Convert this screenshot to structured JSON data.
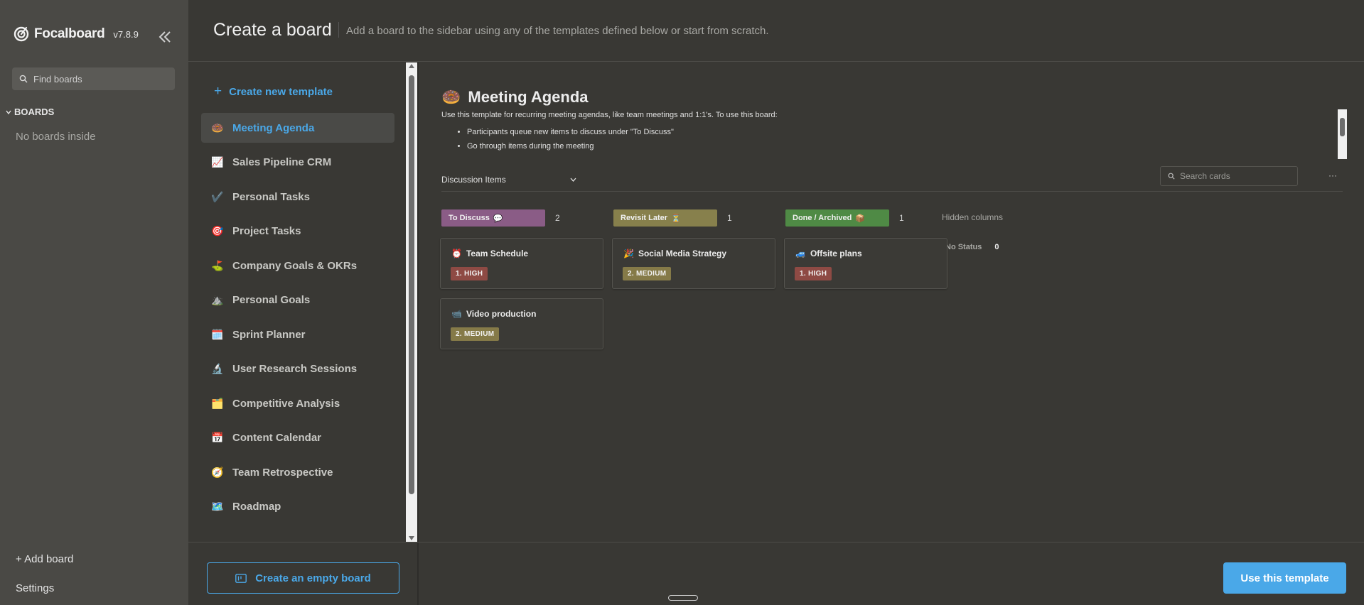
{
  "sidebar": {
    "brand": "Focalboard",
    "version": "v7.8.9",
    "search_placeholder": "Find boards",
    "boards_header": "BOARDS",
    "empty_text": "No boards inside",
    "add_board": "+ Add board",
    "settings": "Settings"
  },
  "header": {
    "title": "Create a board",
    "subtitle": "Add a board to the sidebar using any of the templates defined below or start from scratch."
  },
  "templates": {
    "create_new": "Create new template",
    "items": [
      {
        "label": "Meeting Agenda",
        "icon": "🍩",
        "active": true
      },
      {
        "label": "Sales Pipeline CRM",
        "icon": "📈",
        "active": false
      },
      {
        "label": "Personal Tasks",
        "icon": "✔️",
        "active": false
      },
      {
        "label": "Project Tasks",
        "icon": "🎯",
        "active": false
      },
      {
        "label": "Company Goals & OKRs",
        "icon": "⛳",
        "active": false
      },
      {
        "label": "Personal Goals",
        "icon": "⛰️",
        "active": false
      },
      {
        "label": "Sprint Planner",
        "icon": "🗓️",
        "active": false
      },
      {
        "label": "User Research Sessions",
        "icon": "🔬",
        "active": false
      },
      {
        "label": "Competitive Analysis",
        "icon": "🗂️",
        "active": false
      },
      {
        "label": "Content Calendar",
        "icon": "📅",
        "active": false
      },
      {
        "label": "Team Retrospective",
        "icon": "🧭",
        "active": false
      },
      {
        "label": "Roadmap",
        "icon": "🗺️",
        "active": false
      }
    ]
  },
  "preview": {
    "title": "Meeting Agenda",
    "icon": "🍩",
    "description": "Use this template for recurring meeting agendas, like team meetings and 1:1's. To use this board:",
    "bullets": [
      "Participants queue new items to discuss under \"To Discuss\"",
      "Go through items during the meeting"
    ],
    "view_name": "Discussion Items",
    "search_placeholder": "Search cards",
    "more": "···",
    "columns": [
      {
        "label": "To Discuss",
        "icon": "💬",
        "count": "2",
        "color": "#8a5c86"
      },
      {
        "label": "Revisit Later",
        "icon": "⏳",
        "count": "1",
        "color": "#87804c"
      },
      {
        "label": "Done / Archived",
        "icon": "📦",
        "count": "1",
        "color": "#4f8a45"
      }
    ],
    "hidden_columns": "Hidden columns",
    "no_status": "No Status",
    "no_status_count": "0",
    "cards": [
      {
        "title": "Team Schedule",
        "icon": "⏰",
        "tag": "1. HIGH",
        "tag_color": "#8e4a44"
      },
      {
        "title": "Social Media Strategy",
        "icon": "🎉",
        "tag": "2. MEDIUM",
        "tag_color": "#857a48"
      },
      {
        "title": "Offsite plans",
        "icon": "🚙",
        "tag": "1. HIGH",
        "tag_color": "#8e4a44"
      },
      {
        "title": "Video production",
        "icon": "📹",
        "tag": "2. MEDIUM",
        "tag_color": "#857a48"
      }
    ]
  },
  "footer": {
    "empty_board": "Create an empty board",
    "use_template": "Use this template"
  },
  "colors": {
    "accent": "#4aa8e8",
    "sidebar_bg": "#4a4945",
    "main_bg": "#393834"
  }
}
